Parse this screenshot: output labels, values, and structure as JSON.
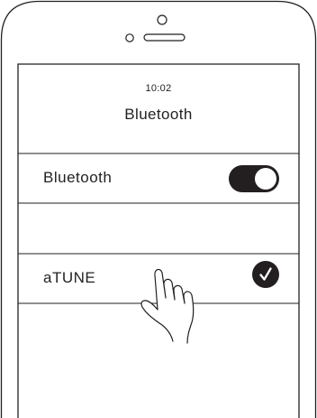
{
  "status_bar": {
    "time": "10:02"
  },
  "screen": {
    "title": "Bluetooth"
  },
  "bluetooth_row": {
    "label": "Bluetooth",
    "toggle_state": "on"
  },
  "device_row": {
    "name": "aTUNE",
    "selected": true
  },
  "colors": {
    "ink": "#231f20",
    "background": "#ffffff"
  },
  "icons": {
    "toggle": "toggle-switch-icon",
    "check": "checkmark-circle-icon",
    "hand": "pointing-hand-icon"
  }
}
